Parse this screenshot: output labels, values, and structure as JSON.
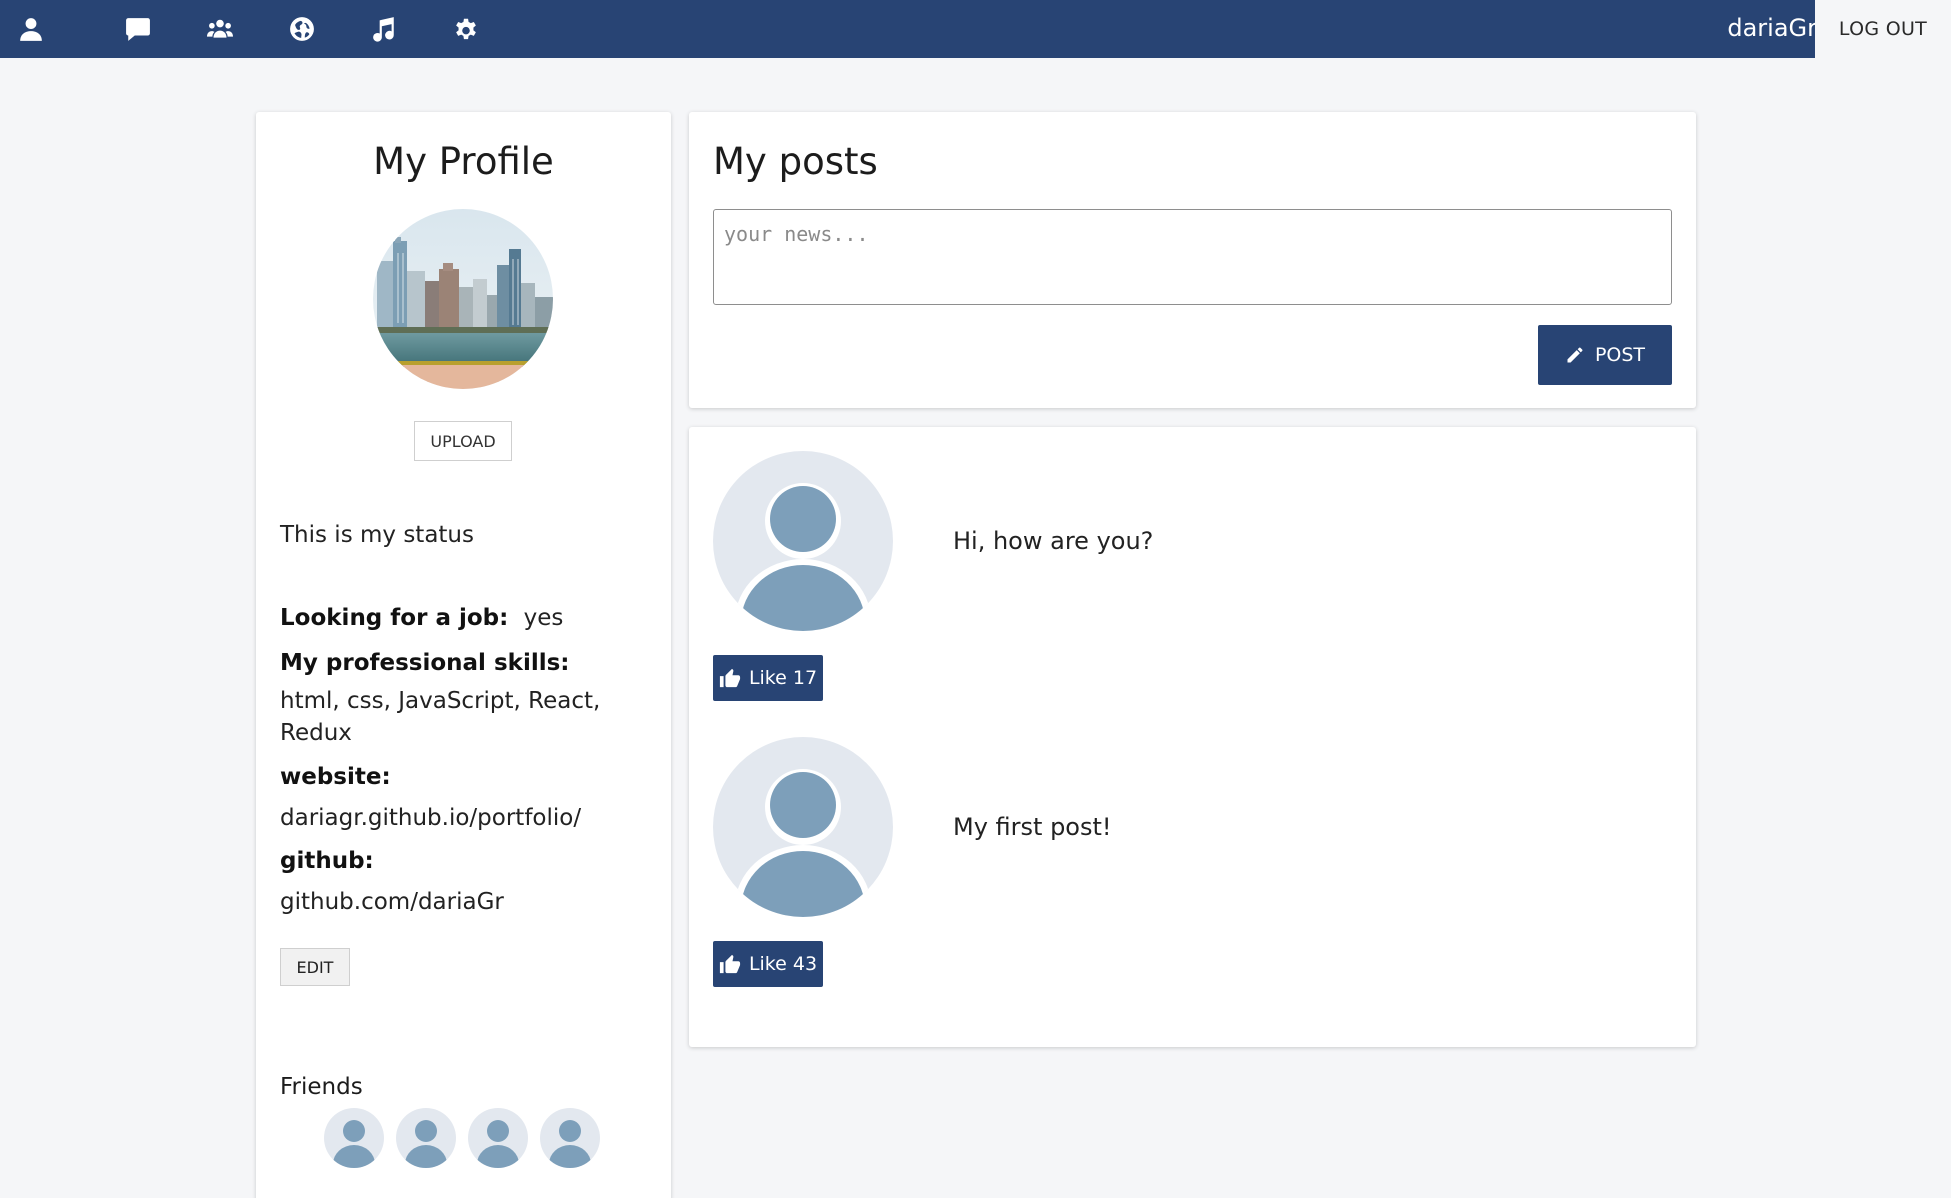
{
  "nav": {
    "icons": [
      "profile-icon",
      "messages-icon",
      "users-icon",
      "news-globe-icon",
      "music-icon",
      "settings-gear-icon"
    ],
    "username": "dariaGr",
    "logout_label": "LOG OUT"
  },
  "profile": {
    "title": "My Profile",
    "upload_label": "UPLOAD",
    "status": "This is my status",
    "job_label": "Looking for a job:",
    "job_value": "yes",
    "skills_label": "My professional skills:",
    "skills_value": "html, css, JavaScript, React, Redux",
    "website_label": "website:",
    "website_value": "dariagr.github.io/portfolio/",
    "github_label": "github:",
    "github_value": "github.com/dariaGr",
    "edit_label": "EDIT",
    "friends_title": "Friends",
    "friends_count": 4
  },
  "new_post": {
    "title": "My posts",
    "placeholder": "your news...",
    "post_label": "POST"
  },
  "posts": [
    {
      "text": "Hi, how are you?",
      "like_label": "Like 17"
    },
    {
      "text": "My first post!",
      "like_label": "Like 43"
    }
  ],
  "colors": {
    "primary": "#284474",
    "background": "#f5f6f8",
    "avatar_bg": "#e3e8ef",
    "avatar_fg": "#7d9fba"
  }
}
